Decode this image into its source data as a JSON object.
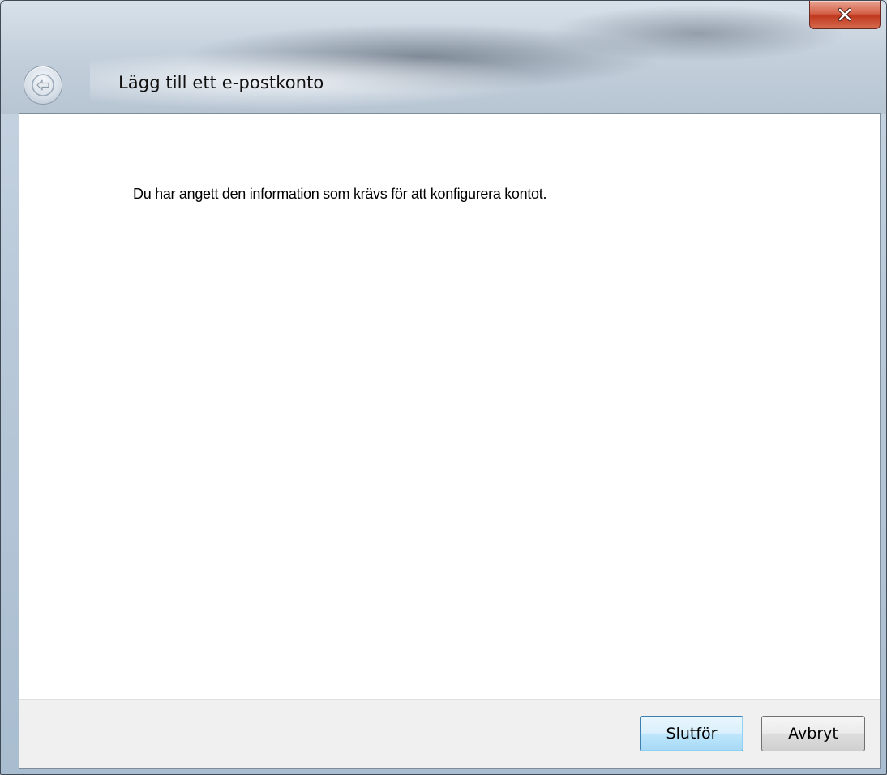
{
  "window": {
    "title": "Lägg till ett e-postkonto"
  },
  "content": {
    "message": "Du har angett den information som krävs för att konfigurera kontot."
  },
  "footer": {
    "finish_label": "Slutför",
    "cancel_label": "Avbryt"
  },
  "icons": {
    "back": "back-arrow-icon",
    "close": "close-x-icon"
  },
  "colors": {
    "close_button": "#c0391f",
    "default_button_border": "#3c7fb1",
    "content_bg": "#ffffff",
    "footer_bg": "#f0f0f0"
  }
}
